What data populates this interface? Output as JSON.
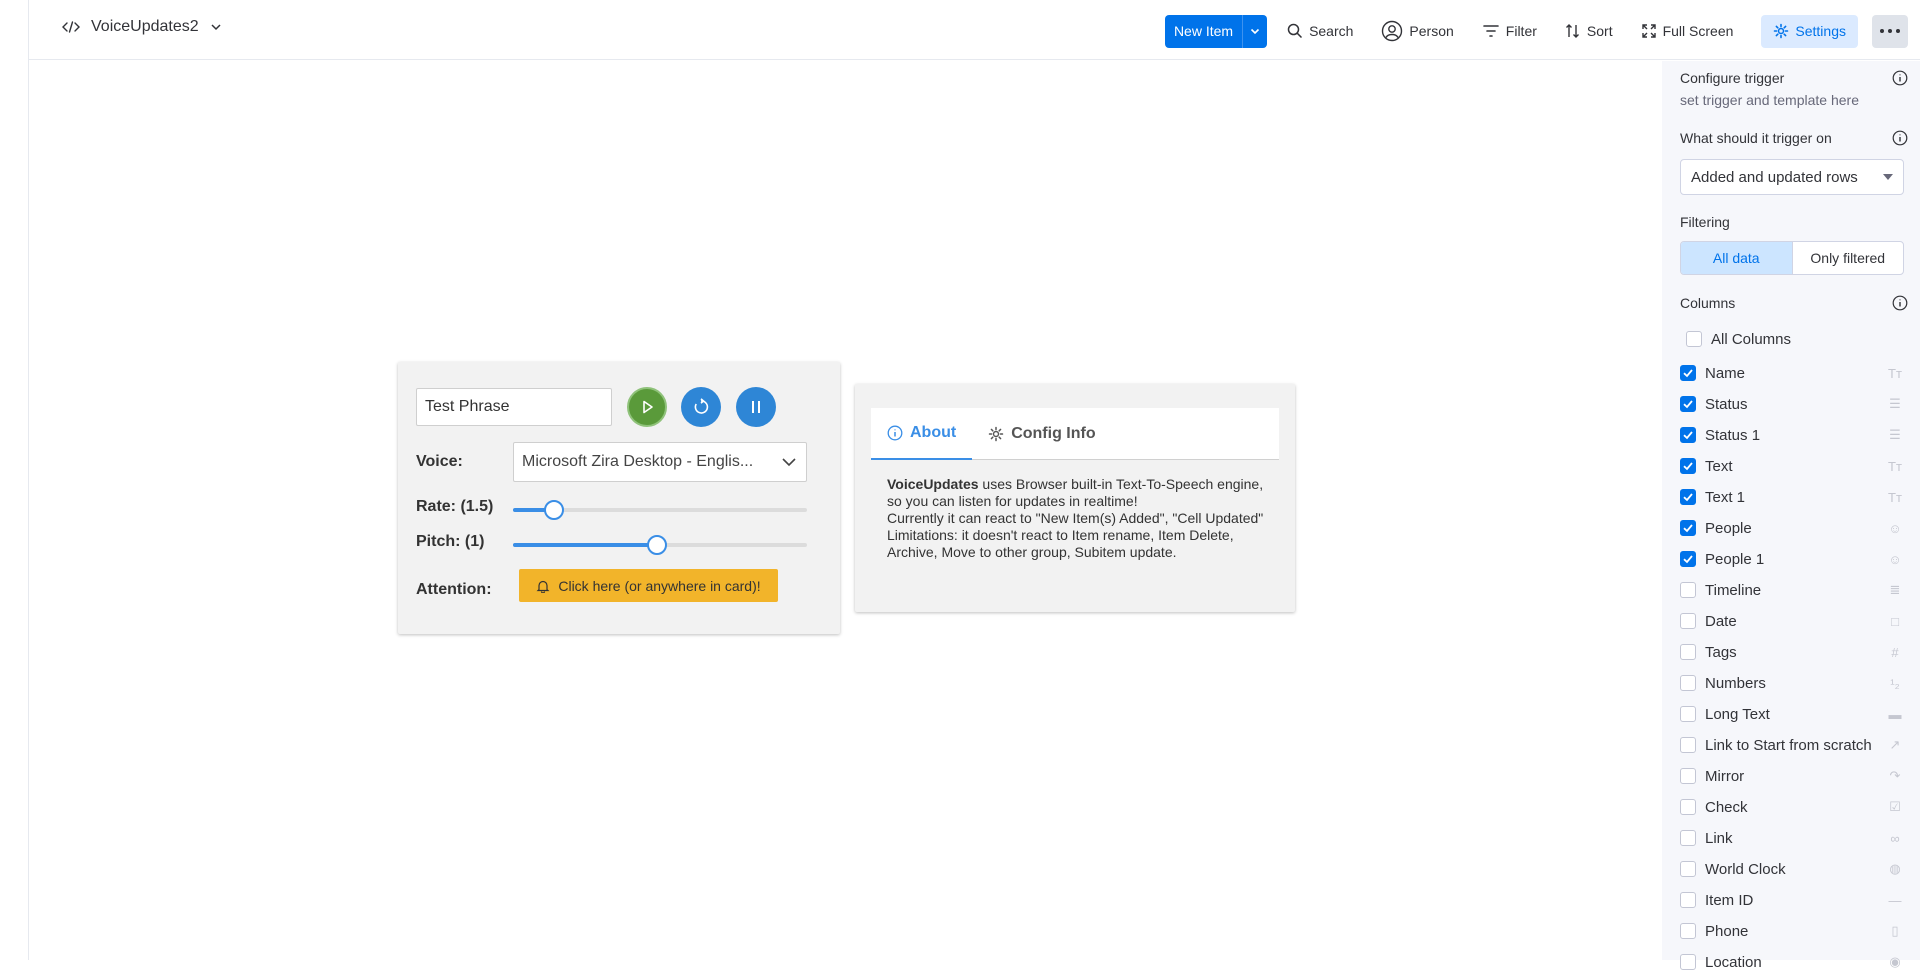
{
  "header": {
    "board_title": "VoiceUpdates2",
    "new_item_label": "New Item",
    "search_label": "Search",
    "person_label": "Person",
    "filter_label": "Filter",
    "sort_label": "Sort",
    "fullscreen_label": "Full Screen",
    "settings_label": "Settings"
  },
  "voice_card": {
    "phrase_value": "Test Phrase",
    "voice_label": "Voice:",
    "voice_value": "Microsoft Zira Desktop - Englis...",
    "rate_label": "Rate: (1.5)",
    "rate_fraction": 0.14,
    "pitch_label": "Pitch: (1)",
    "pitch_fraction": 0.49,
    "attention_label": "Attention:",
    "attention_button": "Click here (or anywhere in card)!"
  },
  "about_card": {
    "tab_about": "About",
    "tab_config": "Config Info",
    "brand": "VoiceUpdates",
    "text_1": " uses Browser built-in Text-To-Speech engine, so you can listen for updates in realtime!",
    "text_2": "Currently it can react to \"New Item(s) Added\", \"Cell Updated\"",
    "text_3": "Limitations: it doesn't react to Item rename, Item Delete, Archive, Move to other group, Subitem update."
  },
  "panel": {
    "configure_title": "Configure trigger",
    "configure_sub": "set trigger and template here",
    "trigger_title": "What should it trigger on",
    "trigger_value": "Added and updated rows",
    "filtering_title": "Filtering",
    "filter_all": "All data",
    "filter_only": "Only filtered",
    "columns_title": "Columns",
    "all_columns": "All Columns",
    "columns": [
      {
        "label": "Name",
        "checked": true,
        "icon": "text-icon"
      },
      {
        "label": "Status",
        "checked": true,
        "icon": "status-icon"
      },
      {
        "label": "Status 1",
        "checked": true,
        "icon": "status-icon"
      },
      {
        "label": "Text",
        "checked": true,
        "icon": "text-icon"
      },
      {
        "label": "Text 1",
        "checked": true,
        "icon": "text-icon"
      },
      {
        "label": "People",
        "checked": true,
        "icon": "people-icon"
      },
      {
        "label": "People 1",
        "checked": true,
        "icon": "people-icon"
      },
      {
        "label": "Timeline",
        "checked": false,
        "icon": "timeline-icon"
      },
      {
        "label": "Date",
        "checked": false,
        "icon": "calendar-icon"
      },
      {
        "label": "Tags",
        "checked": false,
        "icon": "hashtag-icon"
      },
      {
        "label": "Numbers",
        "checked": false,
        "icon": "numbers-icon"
      },
      {
        "label": "Long Text",
        "checked": false,
        "icon": "long-text-icon"
      },
      {
        "label": "Link to Start from scratch",
        "checked": false,
        "icon": "connect-arrow-icon"
      },
      {
        "label": "Mirror",
        "checked": false,
        "icon": "mirror-icon"
      },
      {
        "label": "Check",
        "checked": false,
        "icon": "checkbox-icon"
      },
      {
        "label": "Link",
        "checked": false,
        "icon": "link-icon"
      },
      {
        "label": "World Clock",
        "checked": false,
        "icon": "globe-icon"
      },
      {
        "label": "Item ID",
        "checked": false,
        "icon": "item-id-icon"
      },
      {
        "label": "Phone",
        "checked": false,
        "icon": "phone-icon"
      },
      {
        "label": "Location",
        "checked": false,
        "icon": "location-icon"
      }
    ]
  }
}
